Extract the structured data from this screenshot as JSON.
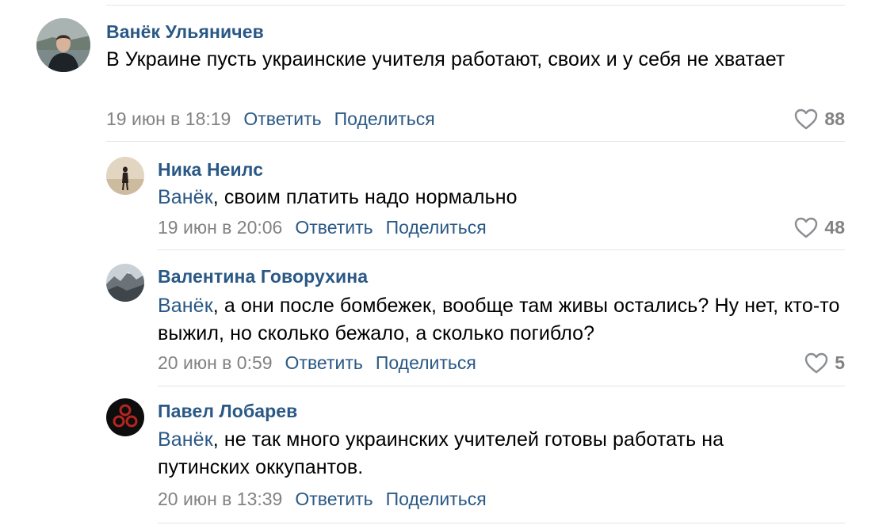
{
  "accent_color": "#2a5885",
  "meta_color": "#828282",
  "reply_label": "Ответить",
  "share_label": "Поделиться",
  "comments": [
    {
      "author": "Ванёк Ульяничев",
      "mention": "",
      "text": "В Украине пусть украинские учителя работают, своих и у себя не хватает",
      "date": "19 июн в 18:19",
      "likes": "88"
    },
    {
      "author": "Ника Неилс",
      "mention": "Ванёк",
      "text": ", своим платить надо нормально",
      "date": "19 июн в 20:06",
      "likes": "48"
    },
    {
      "author": "Валентина Говорухина",
      "mention": "Ванёк",
      "text": ", а они после бомбежек, вообще там живы остались? Ну нет, кто-то выжил, но сколько бежало, а сколько погибло?",
      "date": "20 июн в 0:59",
      "likes": "5"
    },
    {
      "author": "Павел Лобарев",
      "mention": "Ванёк",
      "text": ", не так много украинских учителей готовы работать на путинских оккупантов.",
      "date": "20 июн в 13:39",
      "likes": ""
    }
  ]
}
